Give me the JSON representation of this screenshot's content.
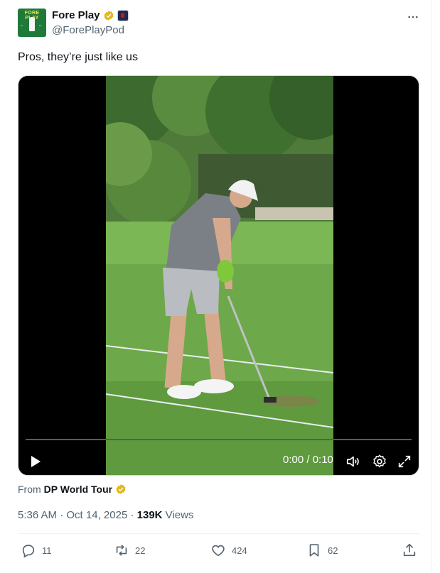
{
  "account": {
    "name": "Fore Play",
    "handle": "@ForePlayPod",
    "avatar_text": "FORE PLAY"
  },
  "tweet": {
    "text": "Pros, they’re just like us"
  },
  "video": {
    "time": "0:00 / 0:10",
    "progress_fraction": 0
  },
  "attribution": {
    "prefix": "From",
    "source": "DP World Tour"
  },
  "meta": {
    "time": "5:36 AM",
    "date": "Oct 14, 2025",
    "views_count": "139K",
    "views_label": "Views"
  },
  "actions": {
    "replies": "11",
    "reposts": "22",
    "likes": "424",
    "bookmarks": "62"
  },
  "colors": {
    "verified_gold": "#e2b719",
    "brand_green": "#1f7a3a",
    "text_secondary": "#536471"
  },
  "icons": [
    "verified-badge-icon",
    "more-icon",
    "play-icon",
    "volume-icon",
    "settings-icon",
    "fullscreen-icon",
    "reply-icon",
    "repost-icon",
    "like-icon",
    "bookmark-icon",
    "share-icon"
  ]
}
